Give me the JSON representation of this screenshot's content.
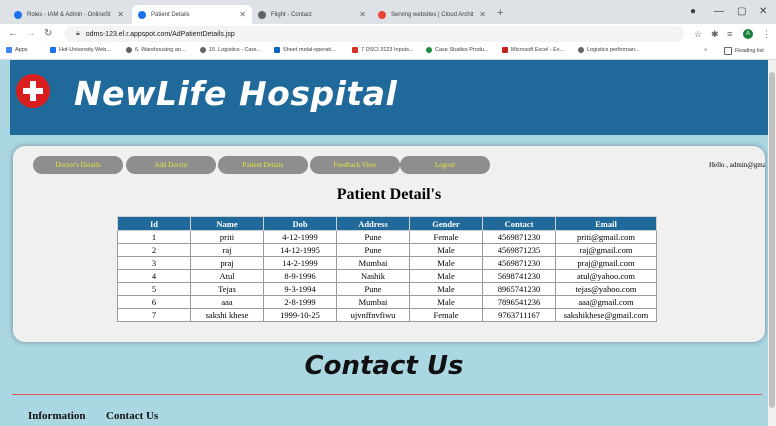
{
  "browser": {
    "tabs": [
      {
        "title": "Roles - IAM & Admin - OnlineSt",
        "favicon_color": "#1a73e8"
      },
      {
        "title": "Patient Details",
        "favicon_color": "#1a73e8"
      },
      {
        "title": "Flight - Contact",
        "favicon_color": "#5f6368"
      },
      {
        "title": "Serving websites | Cloud Archit",
        "favicon_color": "#ea4335"
      }
    ],
    "active_tab": 1,
    "url": "odms-123.el.r.appspot.com/AdPatientDetails.jsp",
    "bookmarks": [
      {
        "label": "Apps",
        "color": "#4285f4"
      },
      {
        "label": "Hof-University Web...",
        "color": "#1a73e8"
      },
      {
        "label": "6. Warehousing an...",
        "color": "#5f6368"
      },
      {
        "label": "15. Logistics - Care...",
        "color": "#5f6368"
      },
      {
        "label": "Sheet metal-operati...",
        "color": "#0a66c2"
      },
      {
        "label": "7 DSCI 3123 Inputs...",
        "color": "#d93025"
      },
      {
        "label": "Case Studies Produ...",
        "color": "#1e8e3e"
      },
      {
        "label": "Microsoft Excel - Ex...",
        "color": "#c5221f"
      },
      {
        "label": "Logistics performan...",
        "color": "#5f6368"
      }
    ],
    "reading_list": "Reading list",
    "profile_initial": "A"
  },
  "site": {
    "brand": "NewLife Hospital",
    "nav": [
      "Doctor's Details",
      "Add Doctor",
      "Patient Details",
      "Feedback View",
      "Logout"
    ],
    "greeting": "Hello , admin@gmail.com",
    "page_title": "Patient Detail's"
  },
  "table": {
    "headers": [
      "Id",
      "Name",
      "Dob",
      "Address",
      "Gender",
      "Contact",
      "Email"
    ],
    "rows": [
      [
        "1",
        "priti",
        "4-12-1999",
        "Pune",
        "Female",
        "4569871230",
        "priti@gmail.com"
      ],
      [
        "2",
        "raj",
        "14-12-1995",
        "Pune",
        "Male",
        "4569871235",
        "raj@gmail.com"
      ],
      [
        "3",
        "praj",
        "14-2-1999",
        "Mumbai",
        "Male",
        "4569871230",
        "praj@gmail.com"
      ],
      [
        "4",
        "Atul",
        "8-9-1996",
        "Nashik",
        "Male",
        "5698741230",
        "atul@yahoo.com"
      ],
      [
        "5",
        "Tejas",
        "9-3-1994",
        "Pune",
        "Male",
        "8965741230",
        "tejas@yahoo.com"
      ],
      [
        "6",
        "aaa",
        "2-8-1999",
        "Mumbai",
        "Male",
        "7896541236",
        "aaa@gmail.com"
      ],
      [
        "7",
        "sakshi khese",
        "1999-10-25",
        "ujvnffnvfiwu",
        "Female",
        "9763711167",
        "sakshikhese@gmail.com"
      ]
    ]
  },
  "contact": {
    "heading": "Contact Us",
    "footer_links": [
      "Information",
      "Contact Us"
    ]
  },
  "colors": {
    "header_bg": "#1f6a9a",
    "page_bg": "#abd7e3",
    "nav_bg": "#8e8e8e",
    "nav_text": "#e6e33c",
    "cross": "#d81e1e"
  }
}
